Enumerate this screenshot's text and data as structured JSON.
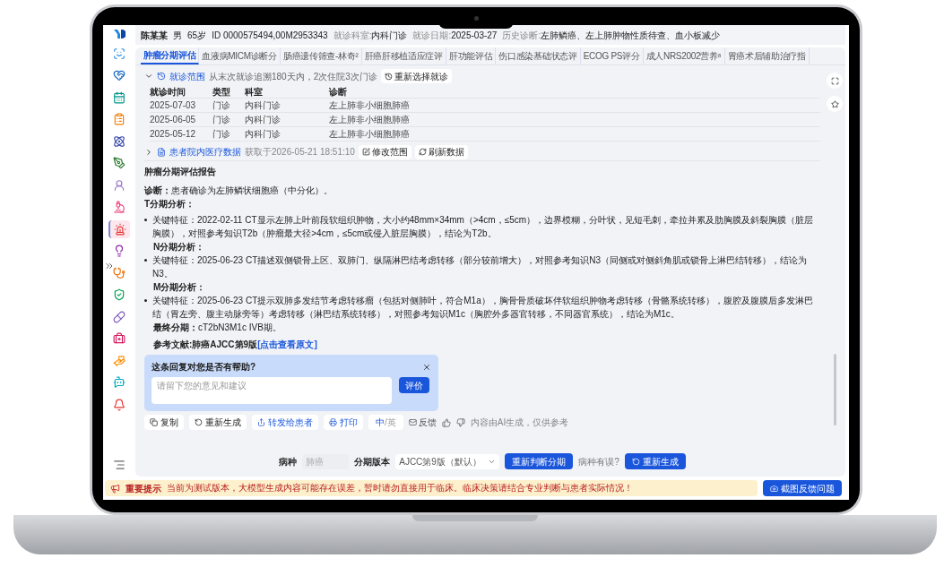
{
  "patient": {
    "name": "陈某某",
    "sex": "男",
    "age": "65岁",
    "id": "ID 0000575494,00M2953343",
    "dept_label": "就诊科室:",
    "dept": "内科门诊",
    "date_label": "就诊日期:",
    "date": "2025-03-27",
    "history_label": "历史诊断:",
    "history": "左肺鳞癌、左上肺肿物性质待查、血小板减少"
  },
  "sidebar": {
    "items": [
      {
        "selected": false
      },
      {
        "selected": false
      },
      {
        "selected": false
      },
      {
        "selected": false
      },
      {
        "selected": false
      },
      {
        "selected": false
      },
      {
        "selected": false
      },
      {
        "selected": false
      },
      {
        "selected": true
      },
      {
        "selected": false
      },
      {
        "selected": false
      },
      {
        "selected": false
      },
      {
        "selected": false
      },
      {
        "selected": false
      },
      {
        "selected": false
      },
      {
        "selected": false
      },
      {
        "selected": false
      }
    ]
  },
  "tabs": [
    {
      "label": "肿瘤分期评估",
      "selected": true
    },
    {
      "label": "血液病MICM诊断分",
      "selected": false
    },
    {
      "label": "肠癌遗传筛查-林奇²",
      "selected": false
    },
    {
      "label": "肝癌肝移植适应症评",
      "selected": false
    },
    {
      "label": "肝功能评估",
      "selected": false
    },
    {
      "label": "伤口感染基础状态评",
      "selected": false
    },
    {
      "label": "ECOG PS评分",
      "selected": false
    },
    {
      "label": "成人NRS2002营养⁸",
      "selected": false
    },
    {
      "label": "胃癌术后辅助治疗指",
      "selected": false
    }
  ],
  "visit_scope": {
    "expanded": true,
    "title": "就诊范围",
    "summary": "从末次就诊追溯180天内，2次住院3次门诊",
    "button": "重新选择就诊"
  },
  "visits": {
    "columns": [
      "就诊时间",
      "类型",
      "科室",
      "诊断"
    ],
    "rows": [
      [
        "2025-07-03",
        "门诊",
        "内科门诊",
        "左上肺非小细胞肺癌"
      ],
      [
        "2025-06-05",
        "门诊",
        "内科门诊",
        "左上肺非小细胞肺癌"
      ],
      [
        "2025-05-12",
        "门诊",
        "内科门诊",
        "左上肺非小细胞肺癌"
      ]
    ]
  },
  "medical_data": {
    "expanded": false,
    "title": "患者院内医疗数据",
    "fetched": "获取于2026-05-21 18:51:10",
    "buttons": [
      "修改范围",
      "刷新数据"
    ]
  },
  "report": {
    "title": "肿瘤分期评估报告",
    "blocks": [
      {
        "kind": "para",
        "text": "**诊断：**患者确诊为左肺鳞状细胞癌（中分化）。"
      },
      {
        "kind": "heading",
        "text": "T分期分析："
      },
      {
        "kind": "bullet",
        "text": "关键特征：2022-02-11 CT显示左肺上叶前段软组织肿物，大小约48mm×34mm（>4cm，≤5cm），边界模糊，分叶状，见短毛刺，牵拉并累及肋胸膜及斜裂胸膜（脏层胸膜），对照参考知识T2b（肿瘤最大径>4cm，≤5cm或侵入脏层胸膜），结论为T2b。"
      },
      {
        "kind": "subheading",
        "text": "N分期分析："
      },
      {
        "kind": "bullet",
        "text": "关键特征：2025-06-23 CT描述双侧锁骨上区、双肺门、纵隔淋巴结考虑转移（部分较前增大），对照参考知识N3（同侧或对侧斜角肌或锁骨上淋巴结转移），结论为N3。"
      },
      {
        "kind": "subheading",
        "text": "M分期分析："
      },
      {
        "kind": "bullet",
        "text": "关键特征：2025-06-23 CT提示双肺多发结节考虑转移瘤（包括对侧肺叶，符合M1a），胸骨骨质破坏伴软组织肿物考虑转移（骨骼系统转移），腹腔及腹膜后多发淋巴结（胃左旁、腹主动脉旁等）考虑转移（淋巴结系统转移），对照参考知识M1c（胸腔外多器官转移，不同器官系统），结论为M1c。"
      },
      {
        "kind": "indent",
        "text": "**最终分期：**cT2bN3M1c IVB期。"
      }
    ],
    "reference": "参考文献:肺癌AJCC第9版",
    "reference_link": "[点击查看原文]"
  },
  "feedback": {
    "question": "这条回复对您是否有帮助?",
    "placeholder": "请留下您的意见和建议",
    "submit": "评价"
  },
  "actions": [
    {
      "kind": "copy",
      "label": "复制"
    },
    {
      "kind": "regenerate",
      "label": "重新生成"
    },
    {
      "kind": "share",
      "label": "转发给患者"
    },
    {
      "kind": "print",
      "label": "打印"
    },
    {
      "kind": "language",
      "separator": "/",
      "options": [
        {
          "label": "中",
          "selected": true
        },
        {
          "label": "英",
          "selected": false
        }
      ]
    }
  ],
  "feedback_link": "反馈",
  "disclaimer": "内容由AI生成，仅供参考",
  "controls": {
    "disease_label": "病种",
    "disease_placeholder": "肺癌",
    "version_label": "分期版本",
    "version": "AJCC第9版（默认）",
    "rejudge": "重新判断分期",
    "wrong_prompt": "病种有误?",
    "regenerate": "重新生成"
  },
  "notice": {
    "title": "重要提示",
    "message": "当前为测试版本，大模型生成内容可能存在误差，暂时请勿直接用于临床。临床决策请结合专业判断与患者实际情况！",
    "button": "截图反馈问题"
  }
}
